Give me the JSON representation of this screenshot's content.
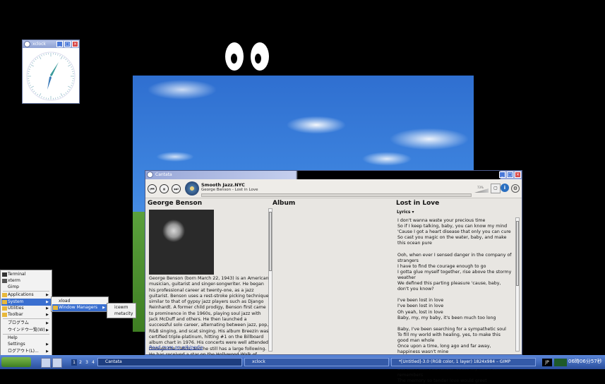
{
  "xclock": {
    "title": "xclock"
  },
  "sky": {},
  "cantata": {
    "title": "Cantata",
    "station": "Smooth Jazz.NYC",
    "now_playing": "George Benson - Lost in Love",
    "volume_label": "73%",
    "artist_heading": "George Benson",
    "album_heading": "Album",
    "song_heading": "Lost in Love",
    "lyrics_label": "Lyrics ▾",
    "bio": "George Benson (born March 22, 1943) is an American musician, guitarist and singer-songwriter. He began his professional career at twenty-one, as a jazz guitarist. Benson uses a rest-stroke picking technique similar to that of gypsy jazz players such as Django Reinhardt. A former child prodigy, Benson first came to prominence in the 1960s, playing soul jazz with Jack McDuff and others. He then launched a successful solo career, alternating between jazz, pop, R&B singing, and scat singing. His album Breezin was certified triple-platinum, hitting #1 on the Billboard album chart in 1976. His concerts were well attended through the 1980s, and he still has a large following. He has received a star on the Hollywood Walk of Fame.",
    "read_more": "Read more on wikipedia",
    "lyrics": "I don't wanna waste your precious time\nSo if I keep talking, baby, you can know my mind\n'Cause I got a heart disease that only you can cure\nSo cast you magic on the water, baby, and make this ocean pure\n\nOoh, when ever I sensed danger in the company of strangers\nI have to find the courage enough to go\nI gotta glue myself together, rise above the stormy weather\nWe defined this parting pleasure 'cause, baby, don't you know?\n\nI've been lost in love\nI've been lost in love\nOh yeah, lost in love\nBaby, my, my baby, it's been much too long\n\nBaby, I've been searching for a sympathetic soul\nTo fill my world with healing, yes, to make this good man whole\nOnce upon a time, long ago and far away, happiness wasn't mine\nThough I prayed, it did not stay, did not stay\n\nBut still I won't surrender 'cause my heart still remembers\nThe memory so tender love would greet"
  },
  "menu": {
    "items": [
      {
        "label": "Terminal"
      },
      {
        "label": "xterm"
      },
      {
        "label": "Gimp"
      },
      {
        "label": "Applications"
      },
      {
        "label": "System"
      },
      {
        "label": "Utilities"
      },
      {
        "label": "Toolbar"
      },
      {
        "label": "プログラム"
      },
      {
        "label": "ウインドウ一覧(W)"
      },
      {
        "label": "Help"
      },
      {
        "label": "Settings"
      },
      {
        "label": "ログアウト(L)..."
      }
    ],
    "system_sub": [
      "xload",
      "Window Managers"
    ],
    "wm_sub": [
      "icewm",
      "metacity"
    ]
  },
  "taskbar": {
    "workspaces": [
      "1",
      "2",
      "3",
      "4"
    ],
    "tasks": [
      "Cantata",
      "xclock",
      "*[Untitled]-3.0 (RGB color, 1 layer) 1824x984 – GIMP"
    ],
    "lang": "JP",
    "clock": "06時06分57秒"
  }
}
